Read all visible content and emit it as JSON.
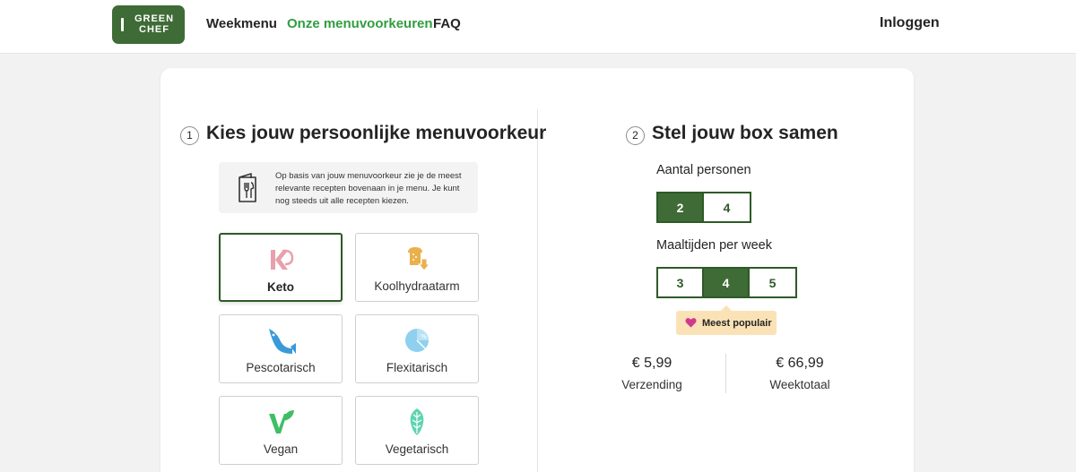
{
  "header": {
    "logo_line1": "GREEN",
    "logo_line2": "CHEF",
    "nav": [
      "Weekmenu",
      "Onze menuvoorkeuren",
      "FAQ"
    ],
    "login": "Inloggen"
  },
  "step1": {
    "number": "1",
    "title": "Kies jouw persoonlijke menuvoorkeur",
    "info_text": "Op basis van jouw menuvoorkeur zie je de meest relevante recepten bovenaan in je menu. Je kunt nog steeds uit alle recepten kiezen.",
    "preferences": [
      {
        "label": "Keto",
        "icon": "keto-shrimp-icon",
        "selected": true
      },
      {
        "label": "Koolhydraatarm",
        "icon": "low-carb-bread-icon",
        "selected": false
      },
      {
        "label": "Pescotarisch",
        "icon": "fish-icon",
        "selected": false
      },
      {
        "label": "Flexitarisch",
        "icon": "flexitarian-percent-icon",
        "selected": false
      },
      {
        "label": "Vegan",
        "icon": "vegan-leaf-icon",
        "selected": false
      },
      {
        "label": "Vegetarisch",
        "icon": "vegetarian-leaf-icon",
        "selected": false
      }
    ]
  },
  "step2": {
    "number": "2",
    "title": "Stel jouw box samen",
    "persons_label": "Aantal personen",
    "persons_options": [
      "2",
      "4"
    ],
    "persons_selected": "2",
    "meals_label": "Maaltijden per week",
    "meals_options": [
      "3",
      "4",
      "5"
    ],
    "meals_selected": "4",
    "badge": "Meest populair",
    "shipping_price": "€ 5,99",
    "shipping_label": "Verzending",
    "total_price": "€ 66,99",
    "total_label": "Weektotaal"
  },
  "colors": {
    "brand_green": "#3f6b36",
    "nav_active_green": "#2f9e3f",
    "badge_bg": "#fbe2b6"
  }
}
